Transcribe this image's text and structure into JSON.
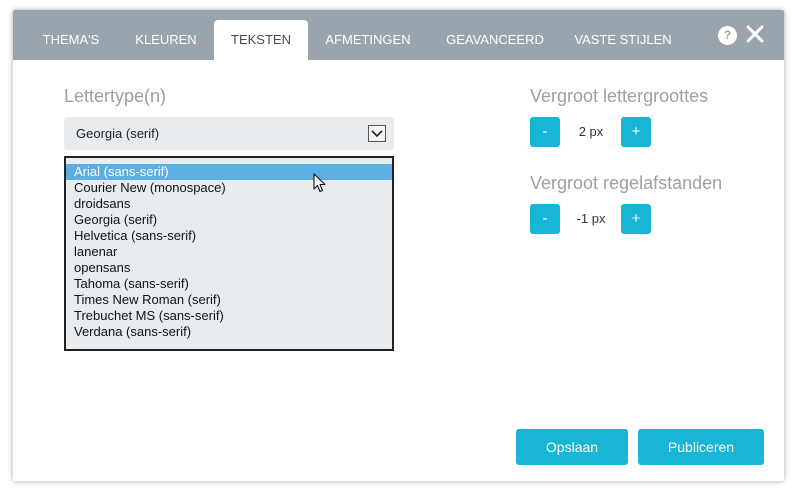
{
  "tabs": [
    {
      "label": "THEMA'S"
    },
    {
      "label": "KLEUREN"
    },
    {
      "label": "TEKSTEN"
    },
    {
      "label": "AFMETINGEN"
    },
    {
      "label": "GEAVANCEERD"
    },
    {
      "label": "VASTE STIJLEN"
    }
  ],
  "header": {
    "help_symbol": "?",
    "help_icon": "help-icon",
    "close_icon": "close-icon"
  },
  "font": {
    "label": "Lettertype(n)",
    "selected_value": "Georgia (serif)",
    "options": [
      "Arial (sans-serif)",
      "Courier New (monospace)",
      "droidsans",
      "Georgia (serif)",
      "Helvetica (sans-serif)",
      "lanenar",
      "opensans",
      "Tahoma (sans-serif)",
      "Times New Roman (serif)",
      "Trebuchet MS (sans-serif)",
      "Verdana (sans-serif)"
    ],
    "highlighted_option": "Arial (sans-serif)"
  },
  "font_size": {
    "label": "Vergroot lettergroottes",
    "minus": "-",
    "value": "2 px",
    "plus": "+"
  },
  "line_height": {
    "label": "Vergroot regelafstanden",
    "minus": "-",
    "value": "-1 px",
    "plus": "+"
  },
  "actions": {
    "save": "Opslaan",
    "publish": "Publiceren"
  },
  "colors": {
    "tabbar": "#9aa4ad",
    "accent": "#19b5d4",
    "highlight": "#5aafe0"
  }
}
